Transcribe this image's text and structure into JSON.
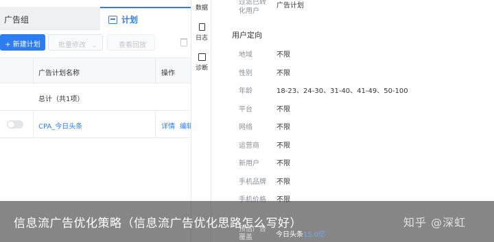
{
  "left": {
    "tabs": {
      "group": "广告组",
      "plan": "计划"
    },
    "toolbar": {
      "new_plan": "+ 新建计划",
      "batch_edit": "批量修改",
      "view_report": "查看回放"
    },
    "table": {
      "headers": {
        "name": "广告计划名称",
        "action": "操作"
      },
      "total_row": "总计（共1项）",
      "rows": [
        {
          "name": "CPA_今日头条",
          "detail": "详情",
          "edit": "编辑"
        }
      ]
    }
  },
  "strip": {
    "items": [
      {
        "label": "数据"
      },
      {
        "label": "日志"
      },
      {
        "label": "诊断"
      }
    ]
  },
  "right": {
    "filter": {
      "label_line1": "过滤已转",
      "label_line2": "化用户",
      "value": "广告计划"
    },
    "section_title": "用户定向",
    "fields": [
      {
        "label": "地域",
        "value": "不限"
      },
      {
        "label": "性别",
        "value": "不限"
      },
      {
        "label": "年龄",
        "value": "18-23、24-30、31-40、41-49、50-100"
      },
      {
        "label": "平台",
        "value": "不限"
      },
      {
        "label": "网络",
        "value": "不限"
      },
      {
        "label": "运营商",
        "value": "不限"
      },
      {
        "label": "新用户",
        "value": "不限"
      },
      {
        "label": "手机品牌",
        "value": "不限"
      },
      {
        "label": "手机价格",
        "value": "不限"
      }
    ],
    "estimate": {
      "label_line1": "预估广告",
      "label_line2": "覆盖",
      "value_prefix": "今日头条",
      "value_num": "15.0亿"
    }
  },
  "overlay": {
    "title": "信息流广告优化策略（信息流广告优化思路怎么写好）",
    "brand": "知乎 @深虹"
  },
  "colors": {
    "accent": "#2d7cf0",
    "overlay": "rgba(60,60,60,0.62)"
  }
}
